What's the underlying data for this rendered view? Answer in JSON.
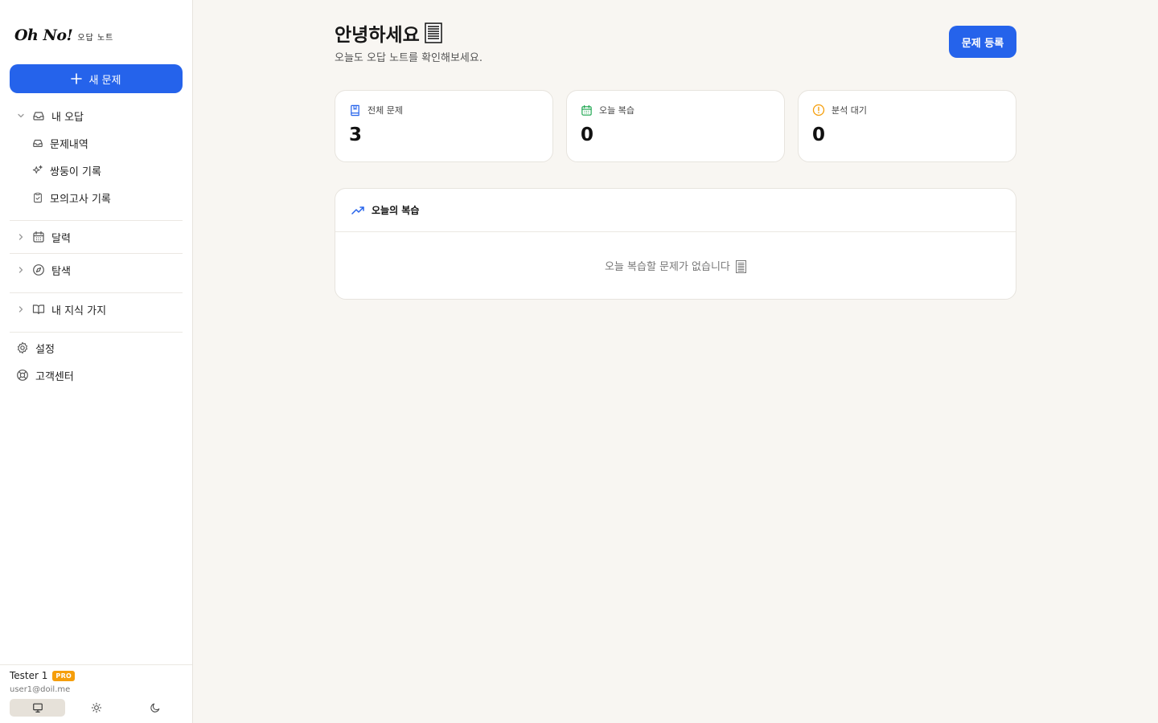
{
  "sidebar": {
    "logo_main": "Oh No!",
    "logo_sub": "오답 노트",
    "new_button": "새 문제",
    "my_wrong": "내 오답",
    "sub_items": [
      "문제내역",
      "쌍둥이 기록",
      "모의고사 기록"
    ],
    "calendar": "달력",
    "explore": "탐색",
    "knowledge": "내 지식 가지",
    "settings": "설정",
    "support": "고객센터"
  },
  "user": {
    "name": "Tester 1",
    "badge": "PRO",
    "email": "user1@doil.me",
    "theme_modes": [
      "system",
      "light",
      "dark"
    ],
    "active_theme": "system"
  },
  "main": {
    "greeting": "안녕하세요",
    "subtitle": "오늘도 오답 노트를 확인해보세요.",
    "register_button": "문제 등록",
    "stats": [
      {
        "label": "전체 문제",
        "value": "3",
        "color": "#2563eb"
      },
      {
        "label": "오늘 복습",
        "value": "0",
        "color": "#16a34a"
      },
      {
        "label": "분석 대기",
        "value": "0",
        "color": "#f59e0b"
      }
    ],
    "review": {
      "title": "오늘의 복습",
      "empty": "오늘 복습할 문제가 없습니다"
    }
  },
  "colors": {
    "accent": "#2563eb",
    "background": "#f8f6f2",
    "badge": "#f59e0b"
  }
}
